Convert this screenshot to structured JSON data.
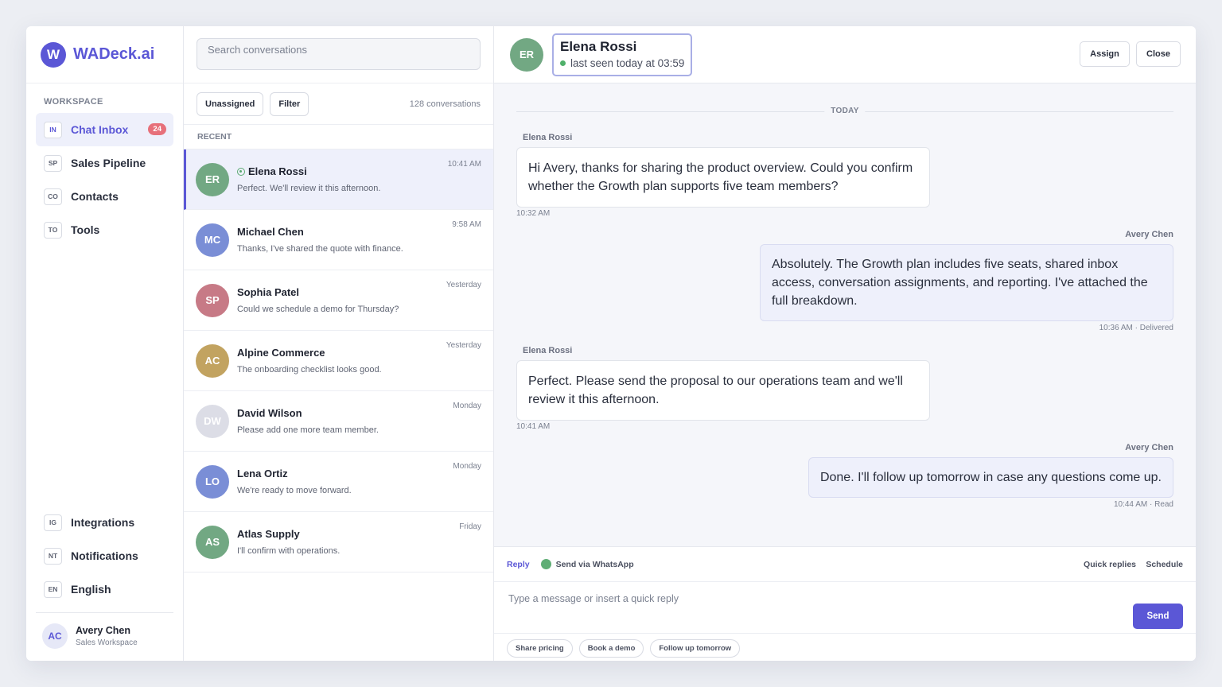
{
  "brand": {
    "logo_letter": "W",
    "name": "WADeck.ai"
  },
  "sidebar": {
    "section_label": "WORKSPACE",
    "items": [
      {
        "code": "IN",
        "label": "Chat Inbox",
        "badge": "24",
        "active": true
      },
      {
        "code": "SP",
        "label": "Sales Pipeline"
      },
      {
        "code": "CO",
        "label": "Contacts"
      },
      {
        "code": "TO",
        "label": "Tools"
      }
    ],
    "bottom_items": [
      {
        "code": "IG",
        "label": "Integrations"
      },
      {
        "code": "NT",
        "label": "Notifications"
      },
      {
        "code": "EN",
        "label": "English"
      }
    ],
    "user": {
      "initials": "AC",
      "name": "Avery Chen",
      "subtitle": "Sales Workspace"
    }
  },
  "conversations": {
    "search_placeholder": "Search conversations",
    "filters": {
      "unassigned": "Unassigned",
      "filter": "Filter"
    },
    "count": "128 conversations",
    "section_label": "RECENT",
    "items": [
      {
        "initials": "ER",
        "name": "Elena Rossi",
        "preview": "Perfect. We'll review it this afternoon.",
        "time": "10:41 AM",
        "color": "#72a883",
        "active": true,
        "online": true
      },
      {
        "initials": "MC",
        "name": "Michael Chen",
        "preview": "Thanks, I've shared the quote with finance.",
        "time": "9:58 AM",
        "color": "#7a8ed6"
      },
      {
        "initials": "SP",
        "name": "Sophia Patel",
        "preview": "Could we schedule a demo for Thursday?",
        "time": "Yesterday",
        "color": "#c77a86"
      },
      {
        "initials": "AC",
        "name": "Alpine Commerce",
        "preview": "The onboarding checklist looks good.",
        "time": "Yesterday",
        "color": "#c2a360"
      },
      {
        "initials": "DW",
        "name": "David Wilson",
        "preview": "Please add one more team member.",
        "time": "Monday",
        "color": "#dcdde6"
      },
      {
        "initials": "LO",
        "name": "Lena Ortiz",
        "preview": "We're ready to move forward.",
        "time": "Monday",
        "color": "#7a8ed6"
      },
      {
        "initials": "AS",
        "name": "Atlas Supply",
        "preview": "I'll confirm with operations.",
        "time": "Friday",
        "color": "#72a883"
      }
    ]
  },
  "chat": {
    "contact": {
      "initials": "ER",
      "name": "Elena Rossi",
      "status": "last seen today at 03:59"
    },
    "actions": {
      "assign": "Assign",
      "close": "Close"
    },
    "day_label": "TODAY",
    "messages": [
      {
        "sender": "Elena Rossi",
        "text": "Hi Avery, thanks for sharing the product overview. Could you confirm whether the Growth plan supports five team members?",
        "meta": "10:32 AM",
        "direction": "in"
      },
      {
        "sender": "Avery Chen",
        "text": "Absolutely. The Growth plan includes five seats, shared inbox access, conversation assignments, and reporting. I've attached the full breakdown.",
        "meta": "10:36 AM · Delivered",
        "direction": "out"
      },
      {
        "sender": "Elena Rossi",
        "text": "Perfect. Please send the proposal to our operations team and we'll review it this afternoon.",
        "meta": "10:41 AM",
        "direction": "in"
      },
      {
        "sender": "Avery Chen",
        "text": "Done. I'll follow up tomorrow in case any questions come up.",
        "meta": "10:44 AM · Read",
        "direction": "out"
      }
    ],
    "composer": {
      "reply_tab": "Reply",
      "channel": "Send via WhatsApp",
      "quick_replies": "Quick replies",
      "schedule": "Schedule",
      "placeholder": "Type a message or insert a quick reply",
      "send": "Send",
      "chips": [
        "Share pricing",
        "Book a demo",
        "Follow up tomorrow"
      ]
    }
  },
  "colors": {
    "accent": "#5b57d6",
    "badge": "#e7707a",
    "online": "#4fb06a",
    "whatsapp": "#5fae75"
  }
}
